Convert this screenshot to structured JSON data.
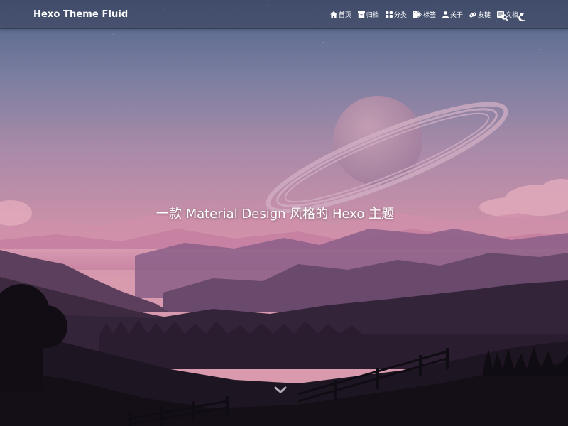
{
  "navbar": {
    "brand": "Hexo Theme Fluid",
    "items": [
      {
        "label": "首页",
        "icon": "home-icon"
      },
      {
        "label": "归档",
        "icon": "archive-icon"
      },
      {
        "label": "分类",
        "icon": "category-icon"
      },
      {
        "label": "标签",
        "icon": "tag-icon"
      },
      {
        "label": "关于",
        "icon": "user-icon"
      },
      {
        "label": "友链",
        "icon": "link-icon"
      },
      {
        "label": "文档",
        "icon": "book-icon",
        "dropdown": true
      }
    ],
    "tools": [
      "search-icon",
      "moon-icon"
    ]
  },
  "hero": {
    "slogan": "一款 Material Design 风格的 Hexo 主题",
    "scroll_icon": "chevron-down-icon"
  },
  "colors": {
    "sky_top": "#5f6f95",
    "sky_mid": "#b98aa6",
    "sky_horizon": "#e1a7b7",
    "foreground": "#17121c",
    "text": "#ffffff"
  }
}
